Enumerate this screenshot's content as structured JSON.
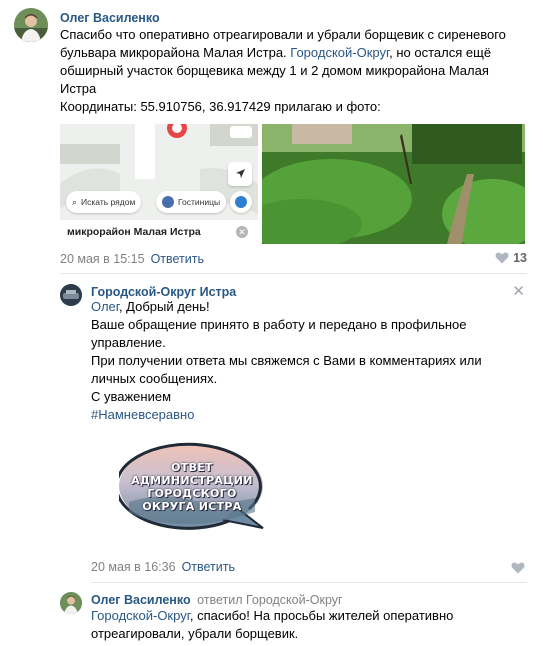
{
  "post": {
    "author": "Олег Василенко",
    "text_line1": "Спасибо что оперативно отреагировали и убрали борщевик с сиреневого",
    "text_line2_a": "бульвара микрорайона Малая Истра. ",
    "text_line2_link": "Городской-Округ",
    "text_line2_b": ", но остался ещё",
    "text_line3": "обширный участок борщевика между 1 и 2 домом микрорайона Малая",
    "text_line4": "Истра",
    "text_line5": "Координаты: 55.910756, 36.917429 прилагаю и фото:",
    "map": {
      "search_chip": "Искать рядом",
      "hotels_chip": "Гостиницы",
      "place_label": "микрорайон Малая Истра"
    },
    "date": "20 мая в 15:15",
    "reply_label": "Ответить",
    "likes": "13"
  },
  "reply": {
    "author": "Городской-Округ Истра",
    "mention": "Олег",
    "greeting": ", Добрый день!",
    "line2": "Ваше обращение принято в работу и передано в профильное",
    "line3": "управление.",
    "line4": "При получении ответа мы свяжемся с Вами в комментариях или",
    "line5": "личных сообщениях.",
    "line6": "С уважением",
    "hashtag": "#Намневсеравно",
    "sticker_lines": [
      "ОТВЕТ",
      "АДМИНИСТРАЦИИ",
      "ГОРОДСКОГО",
      "ОКРУГА ИСТРА"
    ],
    "date": "20 мая в 16:36",
    "reply_label": "Ответить"
  },
  "comment": {
    "author": "Олег Василенко",
    "replied_to": "ответил Городской-Округ",
    "mention": "Городской-Округ",
    "text_a": ", спасибо! На просьбы жителей оперативно",
    "text_b": "отреагировали, убрали борщевик."
  },
  "colors": {
    "link": "#2a5885",
    "muted": "#828282",
    "background": "#ffffff"
  }
}
